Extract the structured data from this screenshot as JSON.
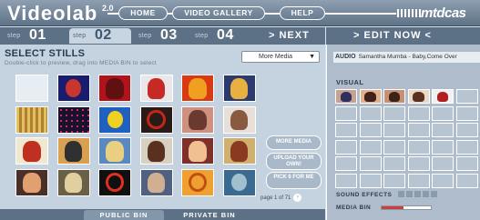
{
  "header": {
    "logo": "Videolab",
    "version": "2.0",
    "nav": [
      "HOME",
      "VIDEO GALLERY",
      "HELP"
    ],
    "brand": "mtdcas"
  },
  "steps": [
    {
      "label": "step",
      "num": "01",
      "active": false
    },
    {
      "label": "step",
      "num": "02",
      "active": true
    },
    {
      "label": "step",
      "num": "03",
      "active": false
    },
    {
      "label": "step",
      "num": "04",
      "active": false
    }
  ],
  "next_label": "> NEXT",
  "stills": {
    "title": "SELECT STILLS",
    "subtitle": "Double-click to preview, drag into MEDIA BIN to select",
    "dropdown_value": "More Media",
    "thumbs": [
      {
        "color": "#e6edf3",
        "accent": "#ffffff",
        "shape": "blank"
      },
      {
        "color": "#1a1d6e",
        "accent": "#c9352f",
        "shape": "circle"
      },
      {
        "color": "#b0131a",
        "accent": "#601010",
        "shape": "blob"
      },
      {
        "color": "#e9e7ea",
        "accent": "#c52a24",
        "shape": "blob"
      },
      {
        "color": "#d93a12",
        "accent": "#f0a020",
        "shape": "blob"
      },
      {
        "color": "#2c3a6e",
        "accent": "#e8b040",
        "shape": "blob"
      },
      {
        "color": "#b08030",
        "accent": "#e0c060",
        "shape": "stripes"
      },
      {
        "color": "#1a1030",
        "accent": "#c83050",
        "shape": "dots"
      },
      {
        "color": "#2060c0",
        "accent": "#f0d020",
        "shape": "circle"
      },
      {
        "color": "#2a1a18",
        "accent": "#c02818",
        "shape": "ring"
      },
      {
        "color": "#d09080",
        "accent": "#6a3a30",
        "shape": "blob"
      },
      {
        "color": "#e8e0d8",
        "accent": "#8a5a40",
        "shape": "blob"
      },
      {
        "color": "#f0e8d0",
        "accent": "#c03020",
        "shape": "blob"
      },
      {
        "color": "#d8a050",
        "accent": "#303030",
        "shape": "blob"
      },
      {
        "color": "#5a88c0",
        "accent": "#e8d080",
        "shape": "blob"
      },
      {
        "color": "#d8d0c0",
        "accent": "#5a3020",
        "shape": "blob"
      },
      {
        "color": "#80302a",
        "accent": "#f0c090",
        "shape": "blob"
      },
      {
        "color": "#d0b070",
        "accent": "#8a3a20",
        "shape": "blob"
      },
      {
        "color": "#4a3028",
        "accent": "#e0a070",
        "shape": "blob"
      },
      {
        "color": "#6a6048",
        "accent": "#e0d0a0",
        "shape": "blob"
      },
      {
        "color": "#101010",
        "accent": "#e03020",
        "shape": "ring"
      },
      {
        "color": "#506080",
        "accent": "#d0b090",
        "shape": "blob"
      },
      {
        "color": "#f0a030",
        "accent": "#c05010",
        "shape": "ring"
      },
      {
        "color": "#3a6a90",
        "accent": "#a0c0d0",
        "shape": "circle"
      }
    ],
    "buttons": [
      "MORE MEDIA",
      "UPLOAD YOUR OWN!",
      "PICK 6 FOR ME"
    ],
    "pager": "page 1 of 71",
    "bins": [
      "PUBLIC BIN",
      "PRIVATE BIN"
    ]
  },
  "edit": {
    "title": "> EDIT NOW <",
    "audio_label": "AUDIO",
    "audio_value": "Samantha Mumba - Baby,Come Over",
    "visual_label": "VISUAL",
    "visual_slots": [
      {
        "color": "#c8a090",
        "accent": "#303060",
        "filled": true
      },
      {
        "color": "#e0b090",
        "accent": "#402018",
        "filled": true
      },
      {
        "color": "#c89070",
        "accent": "#3a2418",
        "filled": true
      },
      {
        "color": "#e8d8c8",
        "accent": "#5a3020",
        "filled": true
      },
      {
        "color": "#f0f0f0",
        "accent": "#b02020",
        "filled": true
      },
      {
        "color": "#b7c5d3",
        "accent": "#b7c5d3",
        "filled": false
      }
    ],
    "sfx_label": "SOUND EFFECTS",
    "media_bin_label": "MEDIA BIN",
    "media_bin_fill": 0.45
  }
}
